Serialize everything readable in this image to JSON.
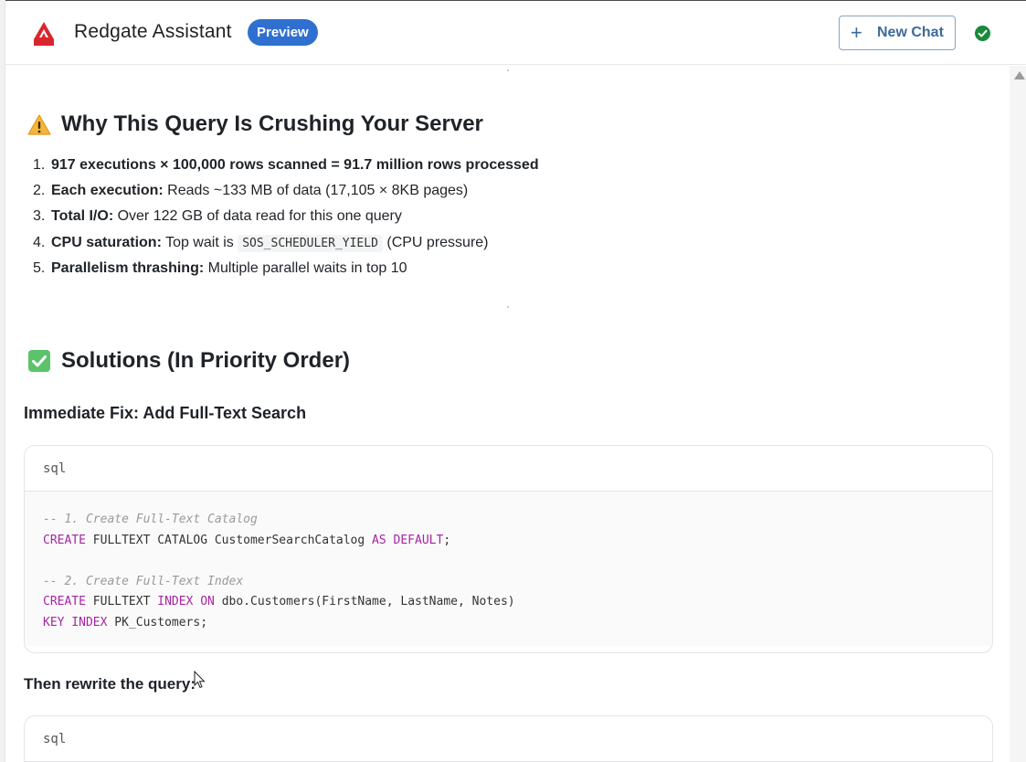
{
  "header": {
    "app_title": "Redgate Assistant",
    "badge": "Preview",
    "new_chat_label": "New Chat",
    "brand_color": "#d9262c",
    "accent_color": "#2f6fd0",
    "status_color": "#1a8a3a"
  },
  "icons": {
    "logo": "redgate-logo-icon",
    "plus": "plus-icon",
    "status": "check-circle-icon",
    "warning": "warning-icon",
    "check": "check-box-icon"
  },
  "section_issues": {
    "heading": "Why This Query Is Crushing Your Server",
    "items": [
      {
        "num": "1.",
        "bold": "917 executions × 100,000 rows scanned = 91.7 million rows processed",
        "text": ""
      },
      {
        "num": "2.",
        "bold": "Each execution:",
        "text": " Reads ~133 MB of data (17,105 × 8KB pages)"
      },
      {
        "num": "3.",
        "bold": "Total I/O:",
        "text": " Over 122 GB of data read for this one query"
      },
      {
        "num": "4.",
        "bold": "CPU saturation:",
        "text_before": " Top wait is ",
        "code": "SOS_SCHEDULER_YIELD",
        "text_after": " (CPU pressure)"
      },
      {
        "num": "5.",
        "bold": "Parallelism thrashing:",
        "text": " Multiple parallel waits in top 10"
      }
    ]
  },
  "section_solutions": {
    "heading": "Solutions (In Priority Order)",
    "subheading_1": "Immediate Fix: Add Full-Text Search",
    "code_1": {
      "lang": "sql",
      "comment_1": "-- 1. Create Full-Text Catalog",
      "line_2_kw1": "CREATE",
      "line_2_mid": " FULLTEXT CATALOG CustomerSearchCatalog ",
      "line_2_kw2": "AS DEFAULT",
      "line_2_end": ";",
      "comment_2": "-- 2. Create Full-Text Index",
      "line_5_kw1": "CREATE",
      "line_5_mid1": " FULLTEXT ",
      "line_5_kw2": "INDEX ON",
      "line_5_end": " dbo.Customers(FirstName, LastName, Notes)",
      "line_6_kw": "KEY INDEX",
      "line_6_end": " PK_Customers;"
    },
    "subheading_2": "Then rewrite the query:",
    "code_2": {
      "lang": "sql"
    }
  }
}
